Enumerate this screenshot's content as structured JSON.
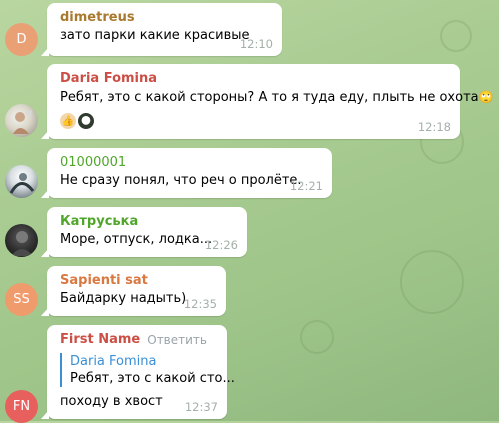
{
  "chat": {
    "messages": [
      {
        "id": "m1",
        "author": "dimetreus",
        "author_color": "#a9792e",
        "avatar": {
          "type": "initial",
          "letter": "D",
          "color": "#eaa075"
        },
        "text": "зато парки какие красивые",
        "time": "12:10"
      },
      {
        "id": "m2",
        "author": "Daria Fomina",
        "author_color": "#cc4f46",
        "avatar": {
          "type": "photo"
        },
        "text": "Ребят, это с какой стороны? А то я туда еду, плыть не охота",
        "emoji": "🙄",
        "reactions": [
          "👍",
          "🌑"
        ],
        "time": "12:18"
      },
      {
        "id": "m3",
        "author": "01000001",
        "author_color": "#4fa62b",
        "avatar": {
          "type": "photo"
        },
        "text": "Не сразу понял, что реч о пролёте.",
        "time": "12:21"
      },
      {
        "id": "m4",
        "author": "Катруська",
        "author_color": "#4fa62b",
        "avatar": {
          "type": "photo"
        },
        "text": "Море, отпуск, лодка...",
        "time": "12:26"
      },
      {
        "id": "m5",
        "author": "Sapienti sat",
        "author_color": "#d97942",
        "avatar": {
          "type": "initial",
          "letter": "SS",
          "color": "#ef9b6c"
        },
        "text": "Байдарку надыть)",
        "time": "12:35"
      },
      {
        "id": "m6",
        "author": "First Name",
        "author_color": "#cc4f46",
        "avatar": {
          "type": "initial",
          "letter": "FN",
          "color": "#e7605e"
        },
        "reply_action": "Ответить",
        "quote": {
          "author": "Daria Fomina",
          "text": "Ребят, это с какой сто..."
        },
        "text": "походу в хвост",
        "time": "12:37"
      }
    ]
  }
}
